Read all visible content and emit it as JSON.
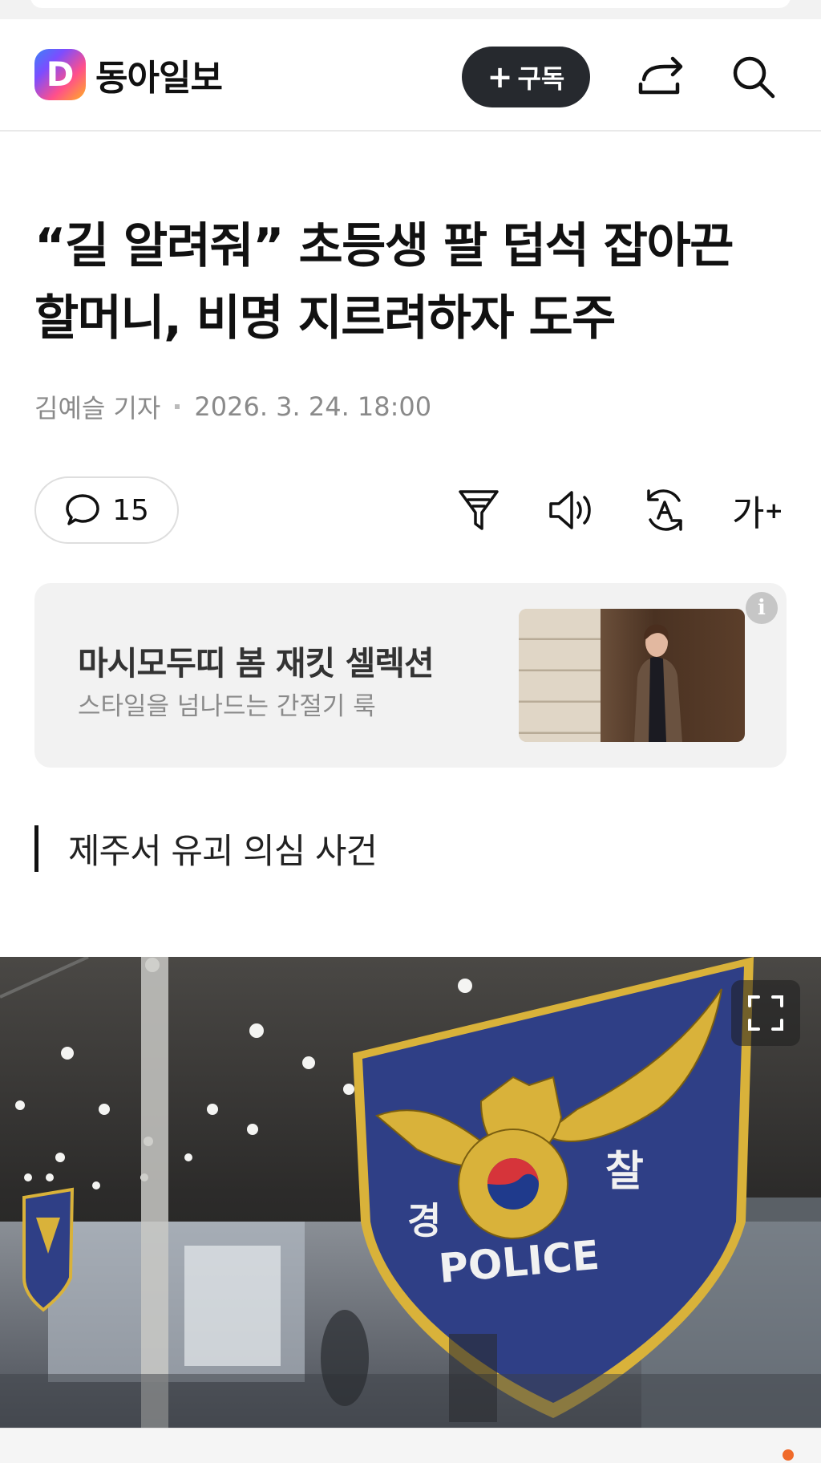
{
  "header": {
    "logo_letter": "D",
    "brand": "동아일보",
    "subscribe_label": "구독",
    "icons": [
      "share-icon",
      "search-icon"
    ]
  },
  "article": {
    "headline_line1": "“길 알려줘” 초등생 팔 덥석 잡아끈",
    "headline_line2": "할머니, 비명 지르려하자 도주",
    "author": "김예슬 기자",
    "date": "2026. 3. 24. 18:00"
  },
  "toolbar": {
    "comment_count": "15",
    "tools": [
      "filter-icon",
      "speaker-icon",
      "translate-icon",
      "font-size-icon"
    ],
    "font_size_label": "가"
  },
  "ad": {
    "title": "마시모두띠 봄 재킷 셀렉션",
    "subtitle": "스타일을 넘나드는 간절기 룩",
    "info_label": "i"
  },
  "section": {
    "label": "제주서 유괴 의심 사건"
  },
  "photo": {
    "badge_left": "경",
    "badge_right": "찰",
    "badge_bottom": "POLICE"
  },
  "colors": {
    "subscribe_bg": "#26292e",
    "badge_blue": "#2f3f86",
    "badge_gold": "#d9b23a",
    "notification_dot": "#f06a2a"
  }
}
